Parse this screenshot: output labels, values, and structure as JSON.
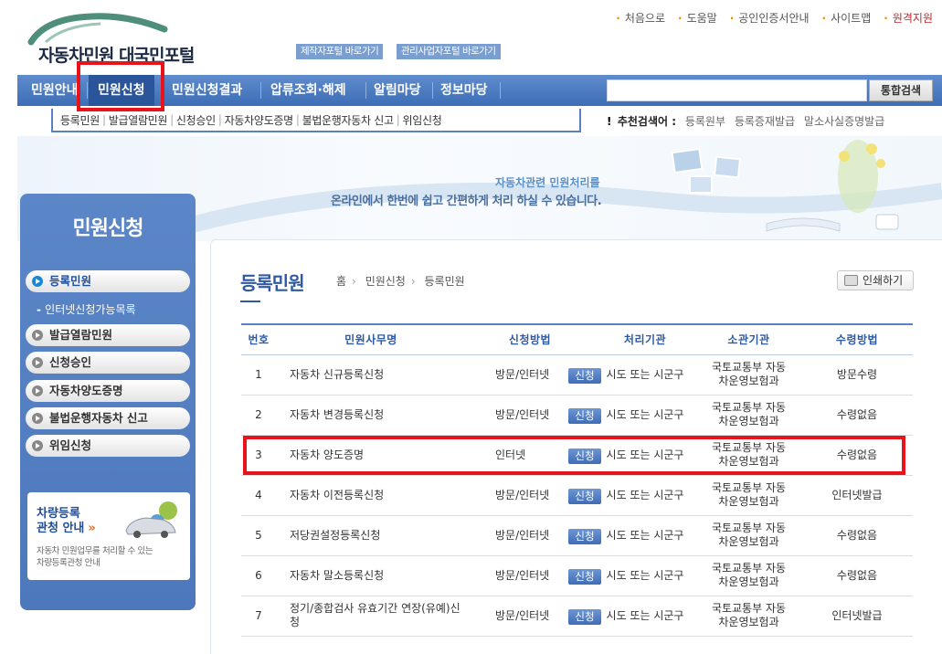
{
  "header": {
    "logo_text": "자동차민원 대국민포털",
    "portal_links": [
      "제작자포털 바로가기",
      "관리사업자포털 바로가기"
    ],
    "util_links": [
      "처음으로",
      "도움말",
      "공인인증서안내",
      "사이트맵",
      "원격지원"
    ]
  },
  "nav": {
    "items": [
      "민원안내",
      "민원신청",
      "민원신청결과",
      "압류조회·해제",
      "알림마당",
      "정보마당"
    ],
    "search_placeholder": "",
    "search_button": "통합검색"
  },
  "subnav": {
    "items": [
      "등록민원",
      "발급열람민원",
      "신청승인",
      "자동차양도증명",
      "불법운행자동차 신고",
      "위임신청"
    ]
  },
  "recommend": {
    "label": "추천검색어 :",
    "keywords": [
      "등록원부",
      "등록증재발급",
      "말소사실증명발급"
    ]
  },
  "banner": {
    "line1": "자동차관련 민원처리를",
    "line2": "온라인에서 한번에 쉽고 간편하게 처리 하실 수 있습니다."
  },
  "sidebar": {
    "title": "민원신청",
    "items": [
      "등록민원",
      "발급열람민원",
      "신청승인",
      "자동차양도증명",
      "불법운행자동차 신고",
      "위임신청"
    ],
    "sub_item": "인터넷신청가능목록",
    "promo_title1": "차량등록",
    "promo_title2": "관청 안내",
    "promo_desc1": "자동차 민원업무를 처리할 수 있는",
    "promo_desc2": "차량등록관청 안내"
  },
  "content": {
    "title": "등록민원",
    "breadcrumb": [
      "홈",
      "민원신청",
      "등록민원"
    ],
    "print_label": "인쇄하기",
    "table": {
      "headers": [
        "번호",
        "민원사무명",
        "신청방법",
        "처리기관",
        "소관기관",
        "수령방법"
      ],
      "apply_label": "신청",
      "rows": [
        {
          "no": "1",
          "name": "자동차 신규등록신청",
          "method": "방문/인터넷",
          "org": "시도 또는 시군구",
          "office1": "국토교통부 자동",
          "office2": "차운영보험과",
          "recv": "방문수령"
        },
        {
          "no": "2",
          "name": "자동차 변경등록신청",
          "method": "방문/인터넷",
          "org": "시도 또는 시군구",
          "office1": "국토교통부 자동",
          "office2": "차운영보험과",
          "recv": "수령없음"
        },
        {
          "no": "3",
          "name": "자동차 양도증명",
          "method": "인터넷",
          "org": "시도 또는 시군구",
          "office1": "국토교통부 자동",
          "office2": "차운영보험과",
          "recv": "수령없음"
        },
        {
          "no": "4",
          "name": "자동차 이전등록신청",
          "method": "방문/인터넷",
          "org": "시도 또는 시군구",
          "office1": "국토교통부 자동",
          "office2": "차운영보험과",
          "recv": "인터넷발급"
        },
        {
          "no": "5",
          "name": "저당권설정등록신청",
          "method": "방문/인터넷",
          "org": "시도 또는 시군구",
          "office1": "국토교통부 자동",
          "office2": "차운영보험과",
          "recv": "수령없음"
        },
        {
          "no": "6",
          "name": "자동차 말소등록신청",
          "method": "방문/인터넷",
          "org": "시도 또는 시군구",
          "office1": "국토교통부 자동",
          "office2": "차운영보험과",
          "recv": "수령없음"
        },
        {
          "no": "7",
          "name": "정기/종합검사 유효기간 연장(유예)신청",
          "method": "방문/인터넷",
          "org": "시도 또는 시군구",
          "office1": "국토교통부 자동",
          "office2": "차운영보험과",
          "recv": "인터넷발급"
        }
      ]
    }
  },
  "colors": {
    "accent": "#2e5aa3",
    "nav": "#4a7bc1",
    "highlight": "#e8141c"
  }
}
